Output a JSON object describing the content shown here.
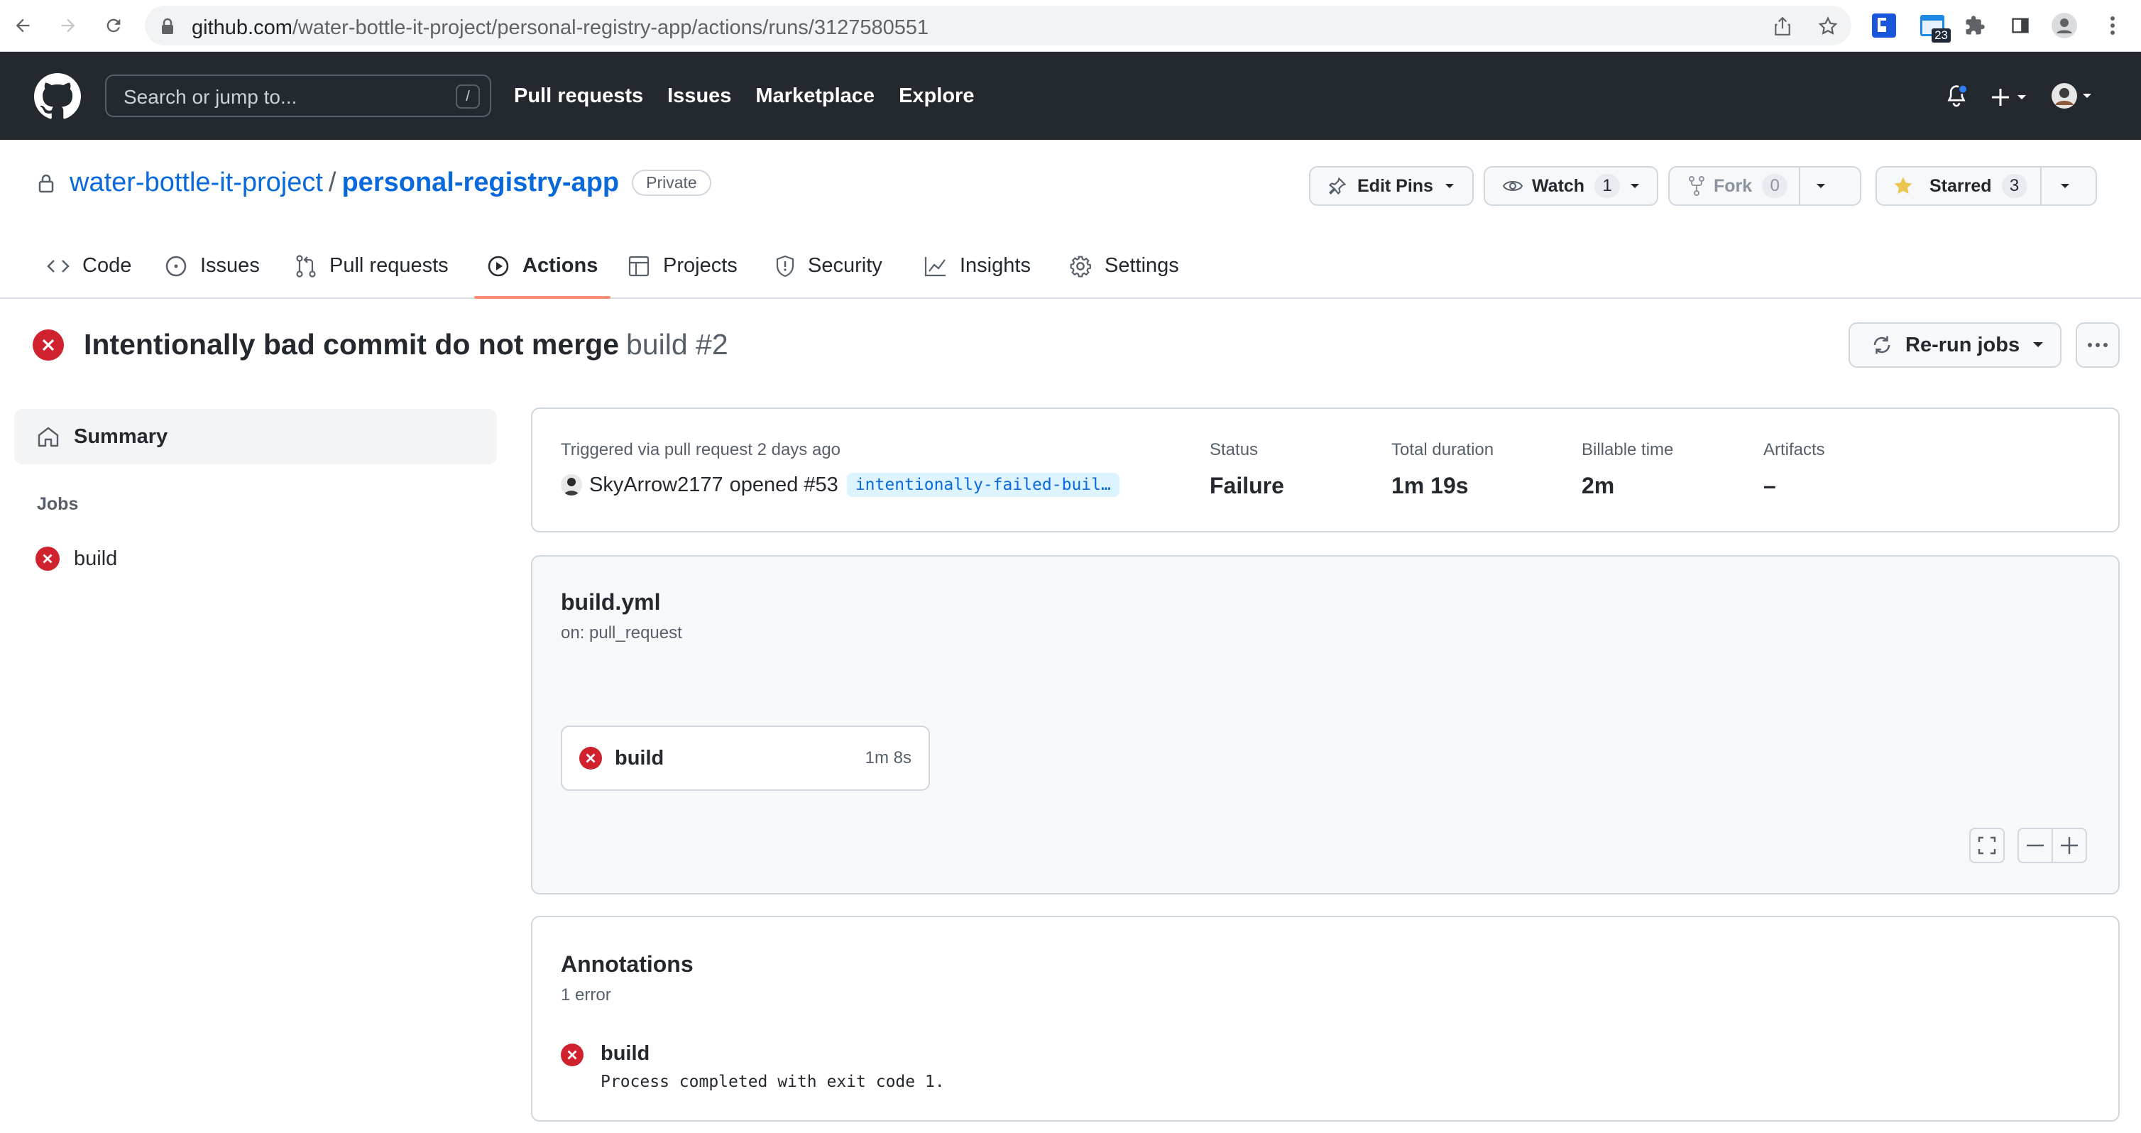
{
  "browser": {
    "url_host": "github.com",
    "url_path": "/water-bottle-it-project/personal-registry-app/actions/runs/3127580551",
    "extension_badge": "23"
  },
  "header": {
    "search_placeholder": "Search or jump to...",
    "search_shortcut": "/",
    "nav": [
      "Pull requests",
      "Issues",
      "Marketplace",
      "Explore"
    ]
  },
  "repo": {
    "owner": "water-bottle-it-project",
    "name": "personal-registry-app",
    "visibility": "Private",
    "actions": {
      "edit_pins": "Edit Pins",
      "watch_label": "Watch",
      "watch_count": "1",
      "fork_label": "Fork",
      "fork_count": "0",
      "star_label": "Starred",
      "star_count": "3"
    },
    "tabs": [
      "Code",
      "Issues",
      "Pull requests",
      "Actions",
      "Projects",
      "Security",
      "Insights",
      "Settings"
    ],
    "selected_tab": "Actions"
  },
  "run": {
    "title": "Intentionally bad commit do not merge",
    "subtitle": "build #2",
    "rerun_label": "Re-run jobs"
  },
  "sidebar": {
    "summary_label": "Summary",
    "jobs_heading": "Jobs",
    "jobs": [
      {
        "name": "build",
        "status": "failure"
      }
    ]
  },
  "summary": {
    "trigger_text": "Triggered via pull request 2 days ago",
    "actor": "SkyArrow2177",
    "action_text": "opened #53",
    "branch": "intentionally-failed-buil…",
    "status_label": "Status",
    "status_value": "Failure",
    "duration_label": "Total duration",
    "duration_value": "1m 19s",
    "billable_label": "Billable time",
    "billable_value": "2m",
    "artifacts_label": "Artifacts",
    "artifacts_value": "–"
  },
  "workflow": {
    "file": "build.yml",
    "trigger": "on: pull_request",
    "jobs": [
      {
        "name": "build",
        "duration": "1m 8s",
        "status": "failure"
      }
    ]
  },
  "annotations": {
    "title": "Annotations",
    "count_text": "1 error",
    "items": [
      {
        "job": "build",
        "message": "Process completed with exit code 1."
      }
    ]
  },
  "colors": {
    "header_bg": "#24292f",
    "link": "#0969da",
    "error": "#cf222e",
    "tab_underline": "#fd8c73",
    "branch_bg": "#ddf4ff"
  }
}
